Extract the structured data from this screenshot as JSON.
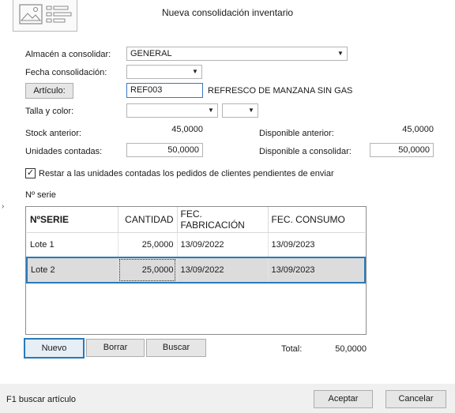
{
  "window": {
    "title": "Nueva consolidación inventario"
  },
  "form": {
    "almacen_label": "Almacén a consolidar:",
    "almacen_value": "GENERAL",
    "fecha_label": "Fecha consolidación:",
    "fecha_value": "",
    "articulo_button": "Artículo:",
    "articulo_value": "REF003",
    "articulo_desc": "REFRESCO DE MANZANA SIN GAS",
    "talla_label": "Talla y color:",
    "talla_value": "",
    "color_value": "",
    "stock_anterior_label": "Stock anterior:",
    "stock_anterior_value": "45,0000",
    "disponible_anterior_label": "Disponible anterior:",
    "disponible_anterior_value": "45,0000",
    "unidades_label": "Unidades contadas:",
    "unidades_value": "50,0000",
    "disponible_consolidar_label": "Disponible a consolidar:",
    "disponible_consolidar_value": "50,0000",
    "restar_checked": true,
    "restar_label": "Restar a las unidades contadas los pedidos de clientes pendientes de enviar",
    "serie_label": "Nº serie"
  },
  "grid": {
    "headers": [
      "NºSERIE",
      "CANTIDAD",
      "FEC. FABRICACIÓN",
      "FEC. CONSUMO"
    ],
    "rows": [
      [
        "Lote 1",
        "25,0000",
        "13/09/2022",
        "13/09/2023"
      ],
      [
        "Lote 2",
        "25,0000",
        "13/09/2022",
        "13/09/2023"
      ]
    ],
    "selected_row": 1
  },
  "actions": {
    "nuevo": "Nuevo",
    "borrar": "Borrar",
    "buscar": "Buscar",
    "total_label": "Total:",
    "total_value": "50,0000"
  },
  "footer": {
    "hint": "F1 buscar artículo",
    "aceptar": "Aceptar",
    "cancelar": "Cancelar"
  },
  "icons": {
    "form_icon": "form-layout-icon",
    "dropdown": "chevron-down-icon",
    "side_arrow": "chevron-right-icon"
  }
}
